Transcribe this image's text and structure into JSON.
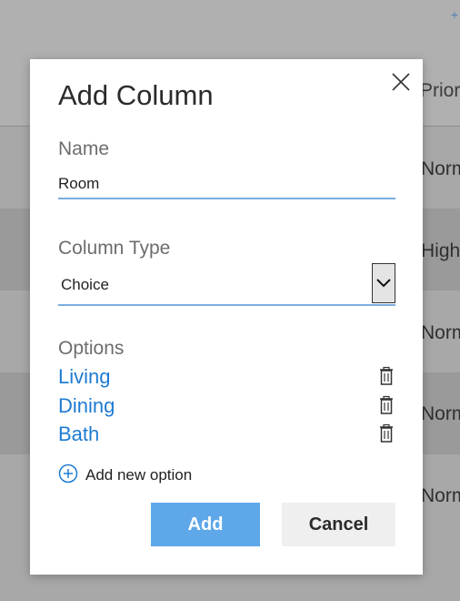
{
  "background": {
    "add_glyph": "+",
    "column_header": "Prior",
    "rows": [
      {
        "priority": "Norm"
      },
      {
        "priority": "High"
      },
      {
        "priority": "Norm"
      },
      {
        "priority": "Norm"
      },
      {
        "priority": "Norm"
      }
    ]
  },
  "dialog": {
    "title": "Add Column",
    "name_label": "Name",
    "name_value": "Room",
    "type_label": "Column Type",
    "type_value": "Choice",
    "options_label": "Options",
    "options": [
      {
        "label": "Living"
      },
      {
        "label": "Dining"
      },
      {
        "label": "Bath"
      }
    ],
    "add_option_label": "Add new option",
    "add_button": "Add",
    "cancel_button": "Cancel"
  },
  "colors": {
    "accent": "#1e7bd1",
    "primary_button": "#5ea7e8",
    "input_underline": "#7aaede"
  },
  "icons": {
    "close": "close-icon",
    "dropdown": "chevron-down-icon",
    "delete": "trash-icon",
    "add": "plus-circle-icon"
  }
}
